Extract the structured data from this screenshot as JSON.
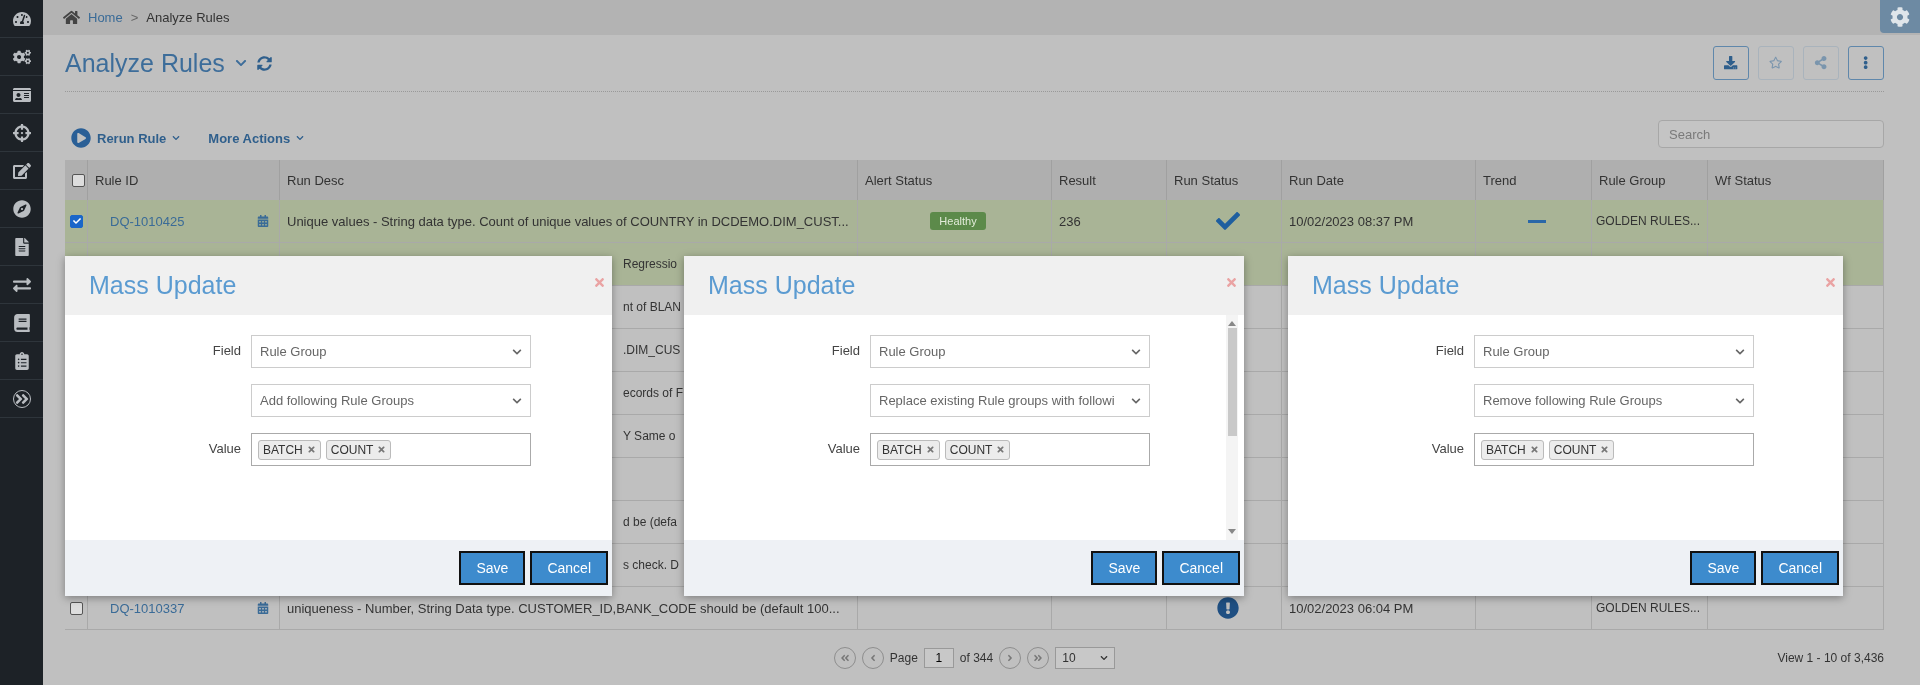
{
  "breadcrumb": {
    "separator": ">",
    "items": [
      {
        "label": "Home",
        "kind": "link"
      },
      {
        "label": "Analyze Rules",
        "kind": "current"
      }
    ]
  },
  "page": {
    "title": "Analyze Rules"
  },
  "toolbar": {
    "actions": [
      "Rerun Rule",
      "More Actions"
    ],
    "search": {
      "placeholder": "Search"
    }
  },
  "table": {
    "all_checked": false,
    "columns": [
      "Rule ID",
      "Run Desc",
      "Alert Status",
      "Result",
      "Run Status",
      "Run Date",
      "Trend",
      "Rule Group",
      "Wf Status"
    ],
    "rows": [
      {
        "kind": "full",
        "selected": true,
        "checked": true,
        "rule_id": "DQ-1010425",
        "run_desc": "Unique values - String data type. Count of unique values of COUNTRY in DCDEMO.DIM_CUST...",
        "alert_status": "Healthy",
        "result": "236",
        "run_status": {
          "kind": "success"
        },
        "run_date": "10/02/2023 08:37 PM",
        "trend": {
          "kind": "flat"
        },
        "rule_group": "GOLDEN RULES..."
      },
      {
        "kind": "partial",
        "selected": true,
        "run_desc": "Regressio"
      },
      {
        "kind": "partial",
        "selected": false,
        "run_desc": "nt of BLAN"
      },
      {
        "kind": "partial",
        "selected": false,
        "run_desc": ".DIM_CUS"
      },
      {
        "kind": "partial",
        "selected": false,
        "run_desc": "ecords of F"
      },
      {
        "kind": "partial",
        "selected": false,
        "run_desc": "Y Same o"
      },
      {
        "kind": "partial",
        "selected": false
      },
      {
        "kind": "partial",
        "selected": false,
        "run_desc": "d be  (defa"
      },
      {
        "kind": "partial",
        "selected": false,
        "run_desc": "s check. D"
      },
      {
        "kind": "full",
        "selected": false,
        "checked": false,
        "rule_id": "DQ-1010337",
        "run_desc": "uniqueness - Number, String Data type. CUSTOMER_ID,BANK_CODE should be  (default 100...",
        "run_status": {
          "kind": "error"
        },
        "run_date": "10/02/2023 06:04 PM",
        "rule_group": "GOLDEN RULES..."
      }
    ]
  },
  "pager": {
    "label": "Page",
    "page": "1",
    "of": "of 344",
    "page_size": "10",
    "summary": "View 1 - 10 of 3,436"
  },
  "dialogs": [
    {
      "title": "Mass Update",
      "field_label": "Field",
      "field": "Rule Group",
      "operation": "Add following Rule Groups",
      "value_label": "Value",
      "tags": [
        "BATCH",
        "COUNT"
      ],
      "buttons": [
        "Save",
        "Cancel"
      ]
    },
    {
      "title": "Mass Update",
      "field_label": "Field",
      "field": "Rule Group",
      "operation": "Replace existing Rule groups with followi",
      "value_label": "Value",
      "tags": [
        "BATCH",
        "COUNT"
      ],
      "scrollbar": true,
      "buttons": [
        "Save",
        "Cancel"
      ]
    },
    {
      "title": "Mass Update",
      "field_label": "Field",
      "field": "Rule Group",
      "operation": "Remove following Rule Groups",
      "value_label": "Value",
      "tags": [
        "BATCH",
        "COUNT"
      ],
      "buttons": [
        "Save",
        "Cancel"
      ]
    }
  ]
}
